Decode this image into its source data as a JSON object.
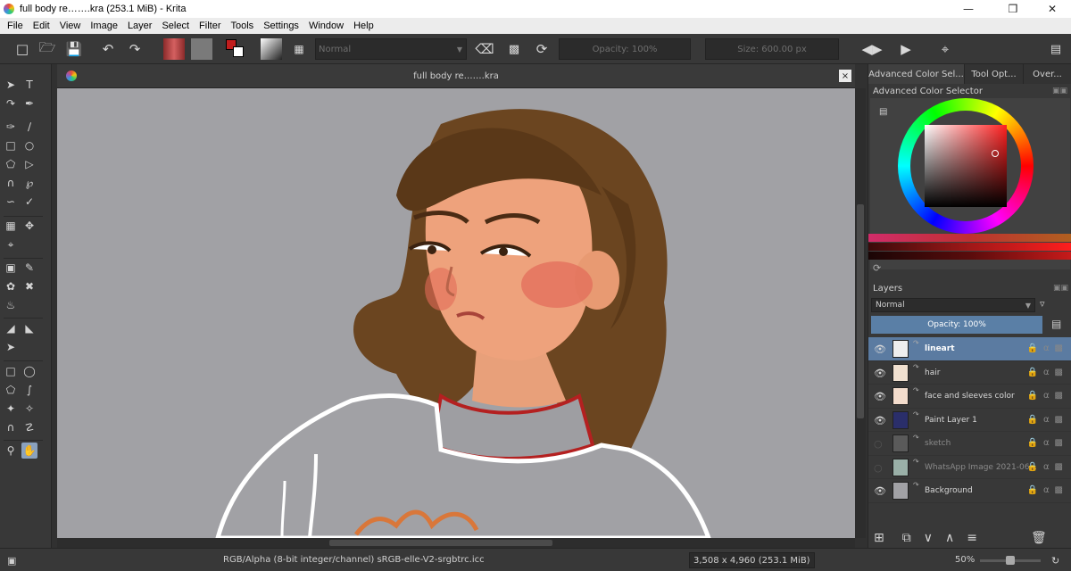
{
  "window": {
    "title": "full body re…….kra (253.1 MiB)  - Krita",
    "minimize": "—",
    "maximize": "❒",
    "close": "✕"
  },
  "menu": [
    "File",
    "Edit",
    "View",
    "Image",
    "Layer",
    "Select",
    "Filter",
    "Tools",
    "Settings",
    "Window",
    "Help"
  ],
  "toolbar": {
    "blend_mode": "Normal",
    "opacity": "Opacity: 100%",
    "size": "Size: 600.00 px",
    "fg_color": "#c01d1d",
    "bg_color": "#ffffff"
  },
  "document": {
    "tab_title": "full body re…….kra",
    "close": "×"
  },
  "dock": {
    "tabs": [
      "Advanced Color Sel...",
      "Tool Opt...",
      "Over..."
    ],
    "color_selector_title": "Advanced Color Selector",
    "layers_title": "Layers",
    "blend_mode": "Normal",
    "opacity": "Opacity:  100%",
    "layers": [
      {
        "name": "lineart",
        "selected": true,
        "visible": true
      },
      {
        "name": "hair",
        "selected": false,
        "visible": true
      },
      {
        "name": "face and sleeves color",
        "selected": false,
        "visible": true
      },
      {
        "name": "Paint Layer 1",
        "selected": false,
        "visible": true
      },
      {
        "name": "sketch",
        "selected": false,
        "visible": false
      },
      {
        "name": "WhatsApp Image 2021-06...",
        "selected": false,
        "visible": false
      },
      {
        "name": "Background",
        "selected": false,
        "visible": true
      }
    ]
  },
  "status": {
    "color_space": "RGB/Alpha (8-bit integer/channel)  sRGB-elle-V2-srgbtrc.icc",
    "dimensions": "3,508 x 4,960 (253.1 MiB)",
    "zoom": "50%"
  }
}
